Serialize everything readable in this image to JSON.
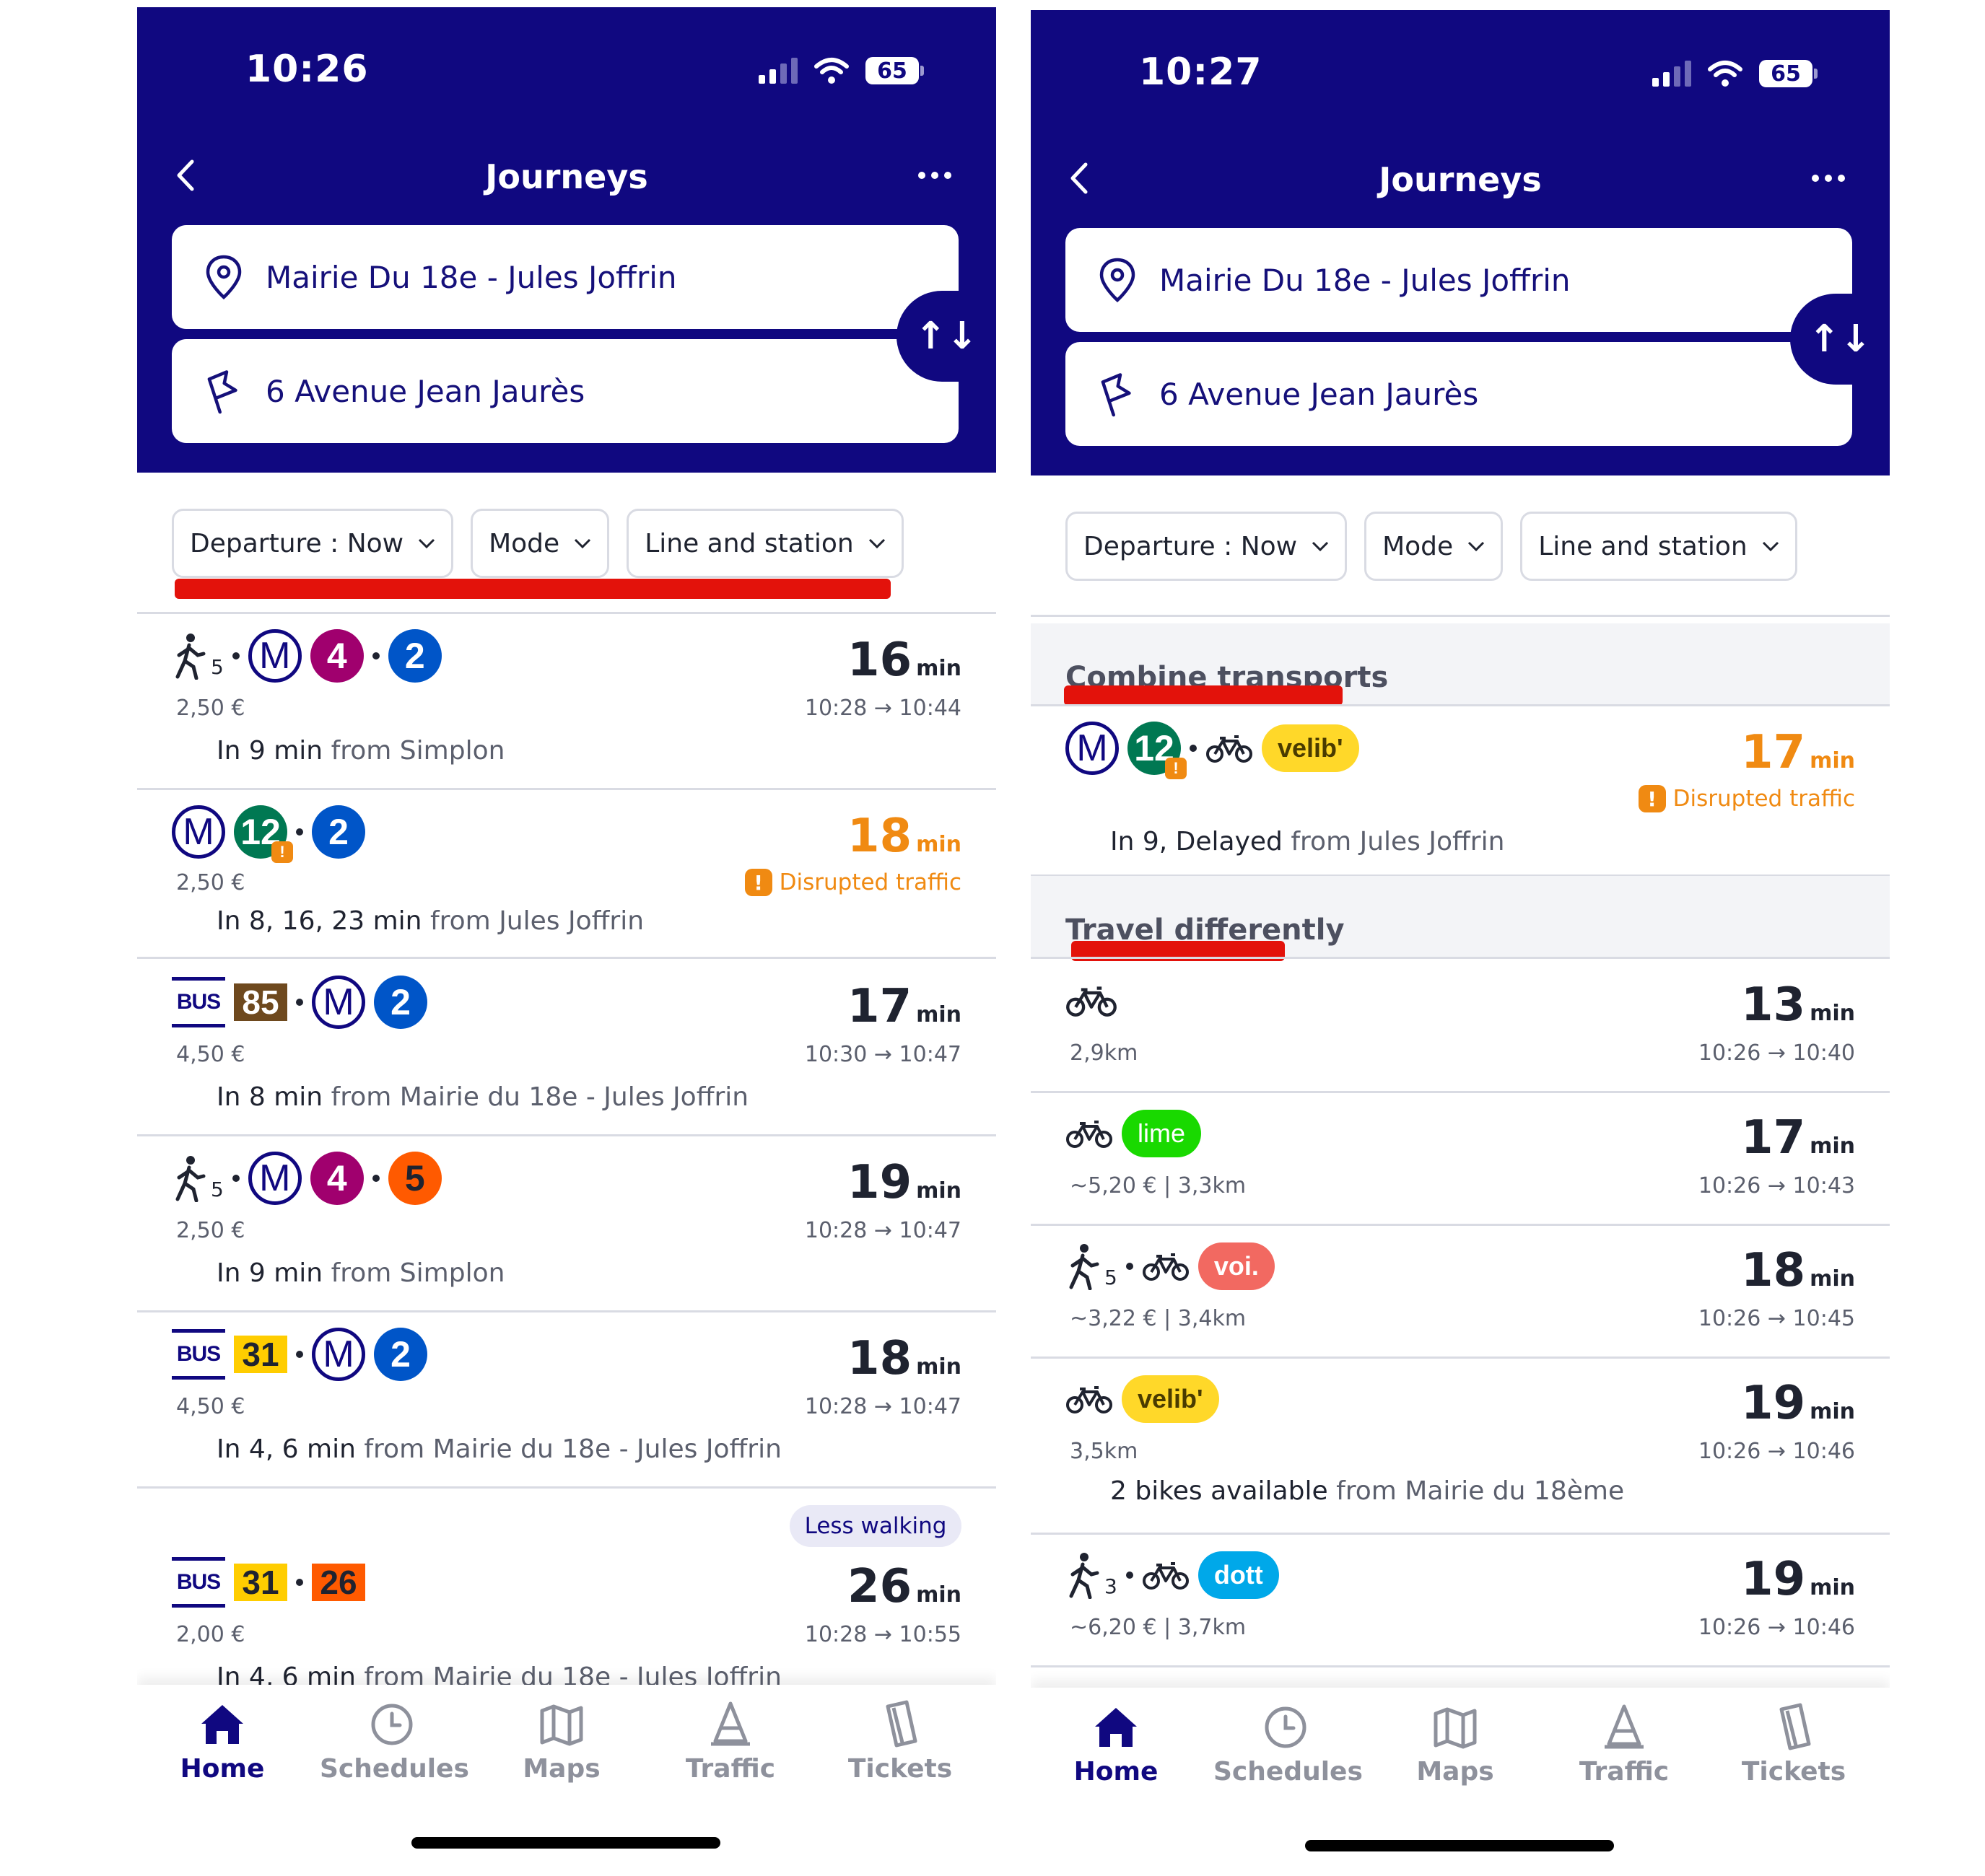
{
  "colors": {
    "brand": "#100880",
    "orange": "#f08a12",
    "red_mark": "#e3120b",
    "metro4": "#a0006e",
    "metro2": "#0055c8",
    "metro12": "#007852",
    "metro5": "#ff5a00",
    "bus85": "#6e491e",
    "bus31": "#ffcd00",
    "bus26": "#ff5a00",
    "lime": "#19d900",
    "voi": "#f26961",
    "dott": "#00a8e9",
    "velib": "#ffd829"
  },
  "left": {
    "status": {
      "time": "10:26",
      "battery": "65"
    },
    "title": "Journeys",
    "from": "Mairie Du 18e - Jules Joffrin",
    "to": "6 Avenue Jean Jaurès",
    "filters": [
      "Departure : Now",
      "Mode",
      "Line and station"
    ],
    "journeys": [
      {
        "walk": "5",
        "price": "2,50 €",
        "duration": "16",
        "unit": "min",
        "times": "10:28 → 10:44",
        "when": "In 9 min",
        "from": "from Simplon"
      },
      {
        "price": "2,50 €",
        "duration": "18",
        "unit": "min",
        "disrupted": "Disrupted traffic",
        "when": "In 8, 16, 23 min",
        "from": "from Jules Joffrin"
      },
      {
        "bus": "85",
        "price": "4,50 €",
        "duration": "17",
        "unit": "min",
        "times": "10:30 → 10:47",
        "when": "In 8 min",
        "from": "from Mairie du 18e - Jules Joffrin"
      },
      {
        "walk": "5",
        "price": "2,50 €",
        "duration": "19",
        "unit": "min",
        "times": "10:28 → 10:47",
        "when": "In 9 min",
        "from": "from Simplon"
      },
      {
        "bus": "31",
        "price": "4,50 €",
        "duration": "18",
        "unit": "min",
        "times": "10:28 → 10:47",
        "when": "In 4, 6 min",
        "from": "from Mairie du 18e - Jules Joffrin"
      },
      {
        "badge": "Less walking",
        "bus": "31",
        "bus2": "26",
        "price": "2,00 €",
        "duration": "26",
        "unit": "min",
        "times": "10:28 → 10:55",
        "when": "In 4, 6 min",
        "from": "from Mairie du 18e - Jules Joffrin"
      }
    ],
    "lines": {
      "bus_label": "BUS",
      "m": "M",
      "m4": "4",
      "m2": "2",
      "m12": "12",
      "m5": "5"
    }
  },
  "right": {
    "status": {
      "time": "10:27",
      "battery": "65"
    },
    "title": "Journeys",
    "from": "Mairie Du 18e - Jules Joffrin",
    "to": "6 Avenue Jean Jaurès",
    "filters": [
      "Departure : Now",
      "Mode",
      "Line and station"
    ],
    "section1": "Combine transports",
    "combine": {
      "m": "M",
      "m12": "12",
      "brand": "velib'",
      "duration": "17",
      "unit": "min",
      "disrupted": "Disrupted traffic",
      "when": "In 9, Delayed",
      "from": "from Jules Joffrin"
    },
    "section2": "Travel differently",
    "alts": [
      {
        "info": "2,9km",
        "duration": "13",
        "unit": "min",
        "times": "10:26 → 10:40"
      },
      {
        "brand": "lime",
        "info": "~5,20 €  | 3,3km",
        "duration": "17",
        "unit": "min",
        "times": "10:26 → 10:43"
      },
      {
        "walk": "5",
        "brand": "voi.",
        "info": "~3,22 €  | 3,4km",
        "duration": "18",
        "unit": "min",
        "times": "10:26 → 10:45"
      },
      {
        "brand": "velib'",
        "info": "3,5km",
        "duration": "19",
        "unit": "min",
        "times": "10:26 → 10:46",
        "when": "2 bikes available",
        "from": "from Mairie du 18ème"
      },
      {
        "walk": "3",
        "brand": "dott",
        "info": "~6,20 €  | 3,7km",
        "duration": "19",
        "unit": "min",
        "times": "10:26 → 10:46"
      }
    ]
  },
  "tabs": [
    "Home",
    "Schedules",
    "Maps",
    "Traffic",
    "Tickets"
  ]
}
